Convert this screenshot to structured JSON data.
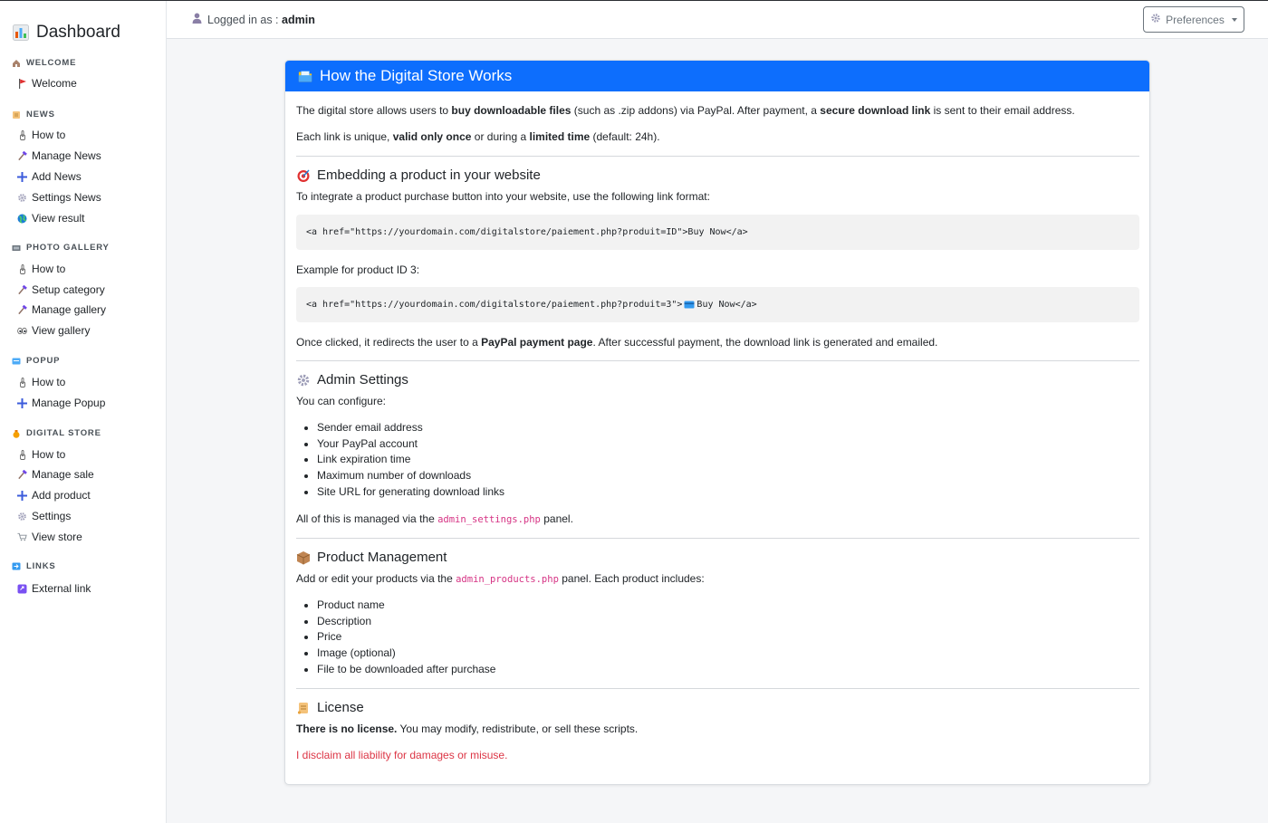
{
  "sidebar": {
    "brand": "Dashboard",
    "sections": [
      {
        "title": "WELCOME",
        "items": [
          {
            "label": "Welcome",
            "icon": "flag-icon"
          }
        ]
      },
      {
        "title": "NEWS",
        "items": [
          {
            "label": "How to",
            "icon": "finger-icon"
          },
          {
            "label": "Manage News",
            "icon": "hammer-icon"
          },
          {
            "label": "Add News",
            "icon": "plus-icon"
          },
          {
            "label": "Settings News",
            "icon": "gear-icon"
          },
          {
            "label": "View result",
            "icon": "globe-icon"
          }
        ]
      },
      {
        "title": "PHOTO GALLERY",
        "items": [
          {
            "label": "How to",
            "icon": "finger-icon"
          },
          {
            "label": "Setup category",
            "icon": "hammer-icon"
          },
          {
            "label": "Manage gallery",
            "icon": "hammer-icon"
          },
          {
            "label": "View gallery",
            "icon": "eyes-icon"
          }
        ]
      },
      {
        "title": "POPUP",
        "items": [
          {
            "label": "How to",
            "icon": "finger-icon"
          },
          {
            "label": "Manage Popup",
            "icon": "plus-icon"
          }
        ]
      },
      {
        "title": "DIGITAL STORE",
        "items": [
          {
            "label": "How to",
            "icon": "finger-icon"
          },
          {
            "label": "Manage sale",
            "icon": "hammer-icon"
          },
          {
            "label": "Add product",
            "icon": "plus-icon"
          },
          {
            "label": "Settings",
            "icon": "gear-icon"
          },
          {
            "label": "View store",
            "icon": "cart-icon"
          }
        ]
      },
      {
        "title": "LINKS",
        "items": [
          {
            "label": "External link",
            "icon": "link-icon"
          }
        ]
      }
    ]
  },
  "topbar": {
    "logged_prefix": "Logged in as : ",
    "username": "admin",
    "preferences_label": "Preferences"
  },
  "card": {
    "title": "How the Digital Store Works",
    "intro": {
      "t1": "The digital store allows users to ",
      "b1": "buy downloadable files",
      "t2": " (such as .zip addons) via PayPal. After payment, a ",
      "b2": "secure download link",
      "t3": " is sent to their email address."
    },
    "unique": {
      "t1": "Each link is unique, ",
      "b1": "valid only once",
      "t2": " or during a ",
      "b2": "limited time",
      "t3": " (default: 24h)."
    },
    "embed": {
      "heading": "Embedding a product in your website",
      "text": "To integrate a product purchase button into your website, use the following link format:",
      "code1": "<a href=\"https://yourdomain.com/digitalstore/paiement.php?produit=ID\">Buy Now</a>",
      "example": "Example for product ID 3:",
      "code2a": "<a href=\"https://yourdomain.com/digitalstore/paiement.php?produit=3\">",
      "code2b": " Buy Now</a>",
      "redirect_t1": "Once clicked, it redirects the user to a ",
      "redirect_b": "PayPal payment page",
      "redirect_t2": ". After successful payment, the download link is generated and emailed."
    },
    "admin": {
      "heading": "Admin Settings",
      "text": "You can configure:",
      "items": [
        "Sender email address",
        "Your PayPal account",
        "Link expiration time",
        "Maximum number of downloads",
        "Site URL for generating download links"
      ],
      "managed_t1": "All of this is managed via the ",
      "managed_code": "admin_settings.php",
      "managed_t2": " panel."
    },
    "products": {
      "heading": "Product Management",
      "text_t1": "Add or edit your products via the ",
      "text_code": "admin_products.php",
      "text_t2": " panel. Each product includes:",
      "items": [
        "Product name",
        "Description",
        "Price",
        "Image (optional)",
        "File to be downloaded after purchase"
      ]
    },
    "license": {
      "heading": "License",
      "bold": "There is no license.",
      "text": " You may modify, redistribute, or sell these scripts.",
      "disclaimer": "I disclaim all liability for damages or misuse."
    }
  },
  "colors": {
    "primary": "#0d6efd",
    "danger": "#dc3545",
    "code_pink": "#d63384"
  }
}
